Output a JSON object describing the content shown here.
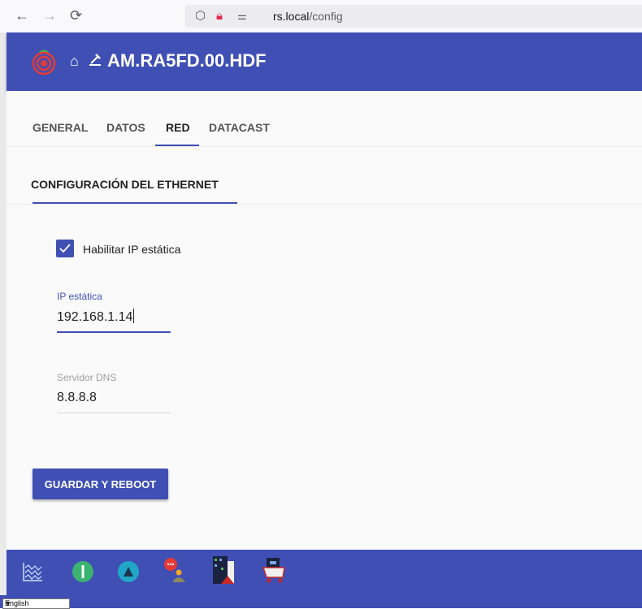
{
  "browser": {
    "back_icon": "arrow-left-icon",
    "forward_icon": "arrow-right-icon",
    "reload_icon": "reload-icon",
    "url_host": "rs.local",
    "url_path": "/config"
  },
  "appbar": {
    "title": "AM.RA5FD.00.HDF",
    "icons": [
      "raspberry-shake-logo",
      "home-icon",
      "seismometer-icon"
    ]
  },
  "tabs": [
    {
      "label": "GENERAL"
    },
    {
      "label": "DATOS"
    },
    {
      "label": "RED",
      "active": true
    },
    {
      "label": "DATACAST"
    }
  ],
  "subtab": {
    "label": "CONFIGURACIÓN DEL ETHERNET"
  },
  "form": {
    "static_ip_checkbox": {
      "label": "Habilitar IP estática",
      "checked": true
    },
    "static_ip": {
      "label": "IP estática",
      "value": "192.168.1.14"
    },
    "dns": {
      "label": "Servidor DNS",
      "value": "8.8.8.8"
    },
    "save_button": "GUARDAR Y REBOOT"
  },
  "bottom_nav": {
    "icons": [
      "helicorder-icon",
      "status-icon",
      "alert-icon",
      "community-icon",
      "station-icon",
      "shop-icon"
    ]
  },
  "language": {
    "selected": "English"
  },
  "colors": {
    "primary": "#3f4fb4",
    "accent_green": "#3cb371",
    "accent_teal": "#21a6c7"
  }
}
